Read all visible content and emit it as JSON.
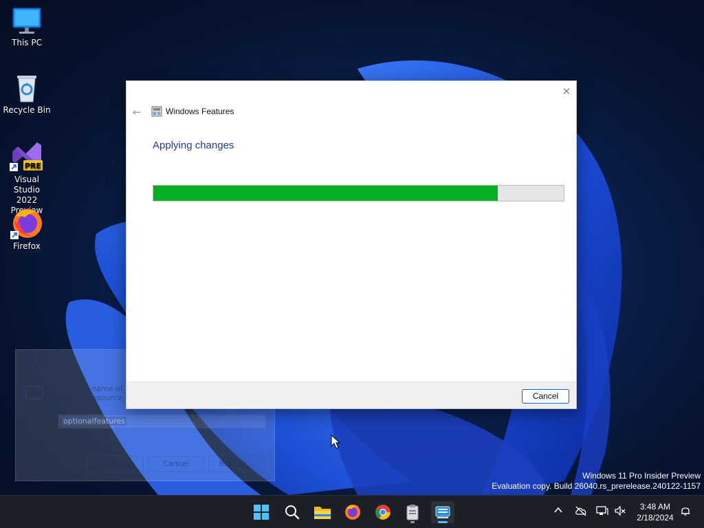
{
  "desktop": {
    "icons": [
      {
        "label": "This PC",
        "icon": "monitor-icon"
      },
      {
        "label": "Recycle Bin",
        "icon": "recycle-bin-icon"
      },
      {
        "label": "Visual Studio 2022 Preview",
        "line1": "Visual Studio",
        "line2": "2022 Preview",
        "badge": "PRE",
        "icon": "visual-studio-icon"
      },
      {
        "label": "Firefox",
        "icon": "firefox-icon"
      }
    ]
  },
  "run_dialog": {
    "title": "Run",
    "description": "Type the name of a program, folder, document, or internet resource, and Windows will open it for you.",
    "open_label": "Open:",
    "open_value": "optionalfeatures",
    "ok_label": "OK",
    "cancel_label": "Cancel",
    "browse_label": "Browse..."
  },
  "dialog": {
    "title": "Windows Features",
    "heading": "Applying changes",
    "progress": 0.84,
    "cancel_label": "Cancel"
  },
  "watermark": {
    "line1": "Windows 11 Pro Insider Preview",
    "line2": "Evaluation copy. Build 26040.rs_prerelease.240122-1157"
  },
  "taskbar": {
    "items": [
      "start-icon",
      "search-icon",
      "file-explorer-icon",
      "firefox-icon",
      "chrome-icon",
      "notepad-icon",
      "windows-features-icon"
    ],
    "clock": {
      "time": "3:48 AM",
      "date": "2/18/2024"
    }
  },
  "colors": {
    "progress_fill": "#06b025",
    "heading": "#1e3f8c",
    "accent": "#0067c0"
  }
}
